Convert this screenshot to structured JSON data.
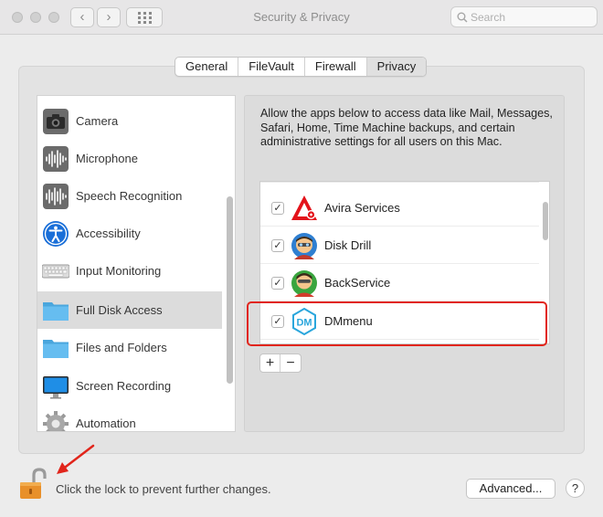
{
  "window": {
    "title": "Security & Privacy"
  },
  "toolbar": {
    "back_icon": "‹",
    "forward_icon": "›"
  },
  "search": {
    "placeholder": "Search"
  },
  "tabs": [
    {
      "label": "General"
    },
    {
      "label": "FileVault"
    },
    {
      "label": "Firewall"
    },
    {
      "label": "Privacy"
    }
  ],
  "selected_tab": "Privacy",
  "sidebar": {
    "items": [
      {
        "label": "Camera",
        "icon": "camera-icon"
      },
      {
        "label": "Microphone",
        "icon": "microphone-icon"
      },
      {
        "label": "Speech Recognition",
        "icon": "speech-recognition-icon"
      },
      {
        "label": "Accessibility",
        "icon": "accessibility-icon"
      },
      {
        "label": "Input Monitoring",
        "icon": "keyboard-icon"
      },
      {
        "label": "Full Disk Access",
        "icon": "folder-icon"
      },
      {
        "label": "Files and Folders",
        "icon": "folder-icon"
      },
      {
        "label": "Screen Recording",
        "icon": "display-icon"
      },
      {
        "label": "Automation",
        "icon": "gear-icon"
      }
    ],
    "selected": "Full Disk Access"
  },
  "description": "Allow the apps below to access data like Mail, Messages, Safari, Home, Time Machine backups, and certain administrative settings for all users on this Mac.",
  "apps": [
    {
      "name": "Avira Services",
      "checked": true,
      "icon": "avira-icon"
    },
    {
      "name": "Disk Drill",
      "checked": true,
      "icon": "disk-drill-icon"
    },
    {
      "name": "BackService",
      "checked": true,
      "icon": "backservice-icon"
    },
    {
      "name": "DMmenu",
      "checked": true,
      "icon": "dmmenu-icon"
    }
  ],
  "list_controls": {
    "add_label": "+",
    "remove_label": "−"
  },
  "checkmark": "✓",
  "lock": {
    "text": "Click the lock to prevent further changes.",
    "state": "unlocked"
  },
  "advanced_label": "Advanced...",
  "help_label": "?",
  "colors": {
    "highlight": "#e1251b",
    "folder": "#5ab4e8",
    "accessibility": "#1a6fd8"
  }
}
